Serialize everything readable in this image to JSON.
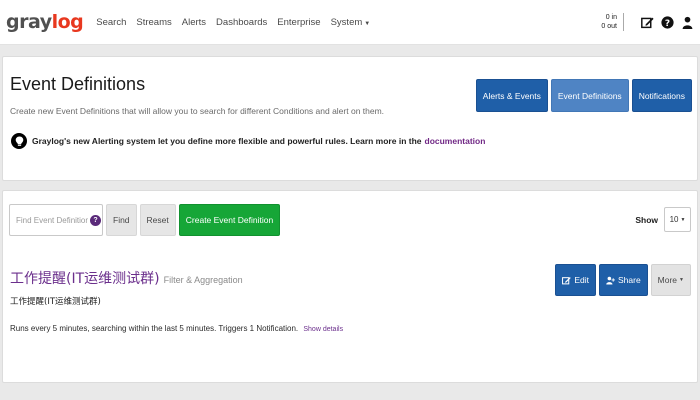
{
  "navbar": {
    "brand": {
      "part1": "gray",
      "part2": "log"
    },
    "links": [
      "Search",
      "Streams",
      "Alerts",
      "Dashboards",
      "Enterprise",
      "System"
    ],
    "throughput": {
      "in": "0 in",
      "out": "0 out"
    },
    "icons": [
      "edit-icon",
      "help-icon",
      "user-icon"
    ]
  },
  "header": {
    "title": "Event Definitions",
    "description": "Create new Event Definitions that will allow you to search for different Conditions and alert on them.",
    "notice": "Graylog's new Alerting system let you define more flexible and powerful rules. Learn more in the",
    "notice_link": "documentation",
    "buttons": {
      "alerts_events": "Alerts & Events",
      "event_definitions": "Event Definitions",
      "notifications": "Notifications"
    }
  },
  "list": {
    "search_placeholder": "Find Event Definitions",
    "help": "?",
    "find": "Find",
    "reset": "Reset",
    "create": "Create Event Definition",
    "show_label": "Show",
    "show_value": "10",
    "items": [
      {
        "name": "工作提醒(IT运维测试群)",
        "type": "Filter & Aggregation",
        "description": "工作提醒(IT运维测试群)",
        "schedule": "Runs every 5 minutes, searching within the last 5 minutes. Triggers 1 Notification.",
        "details_link": "Show details",
        "edit": "Edit",
        "share": "Share",
        "more": "More"
      }
    ]
  },
  "colors": {
    "primary": "#1f5fa8",
    "primary_active": "#4f84c4",
    "success": "#16a637",
    "link": "#6b2f8c",
    "brand_red": "#e8381f"
  }
}
